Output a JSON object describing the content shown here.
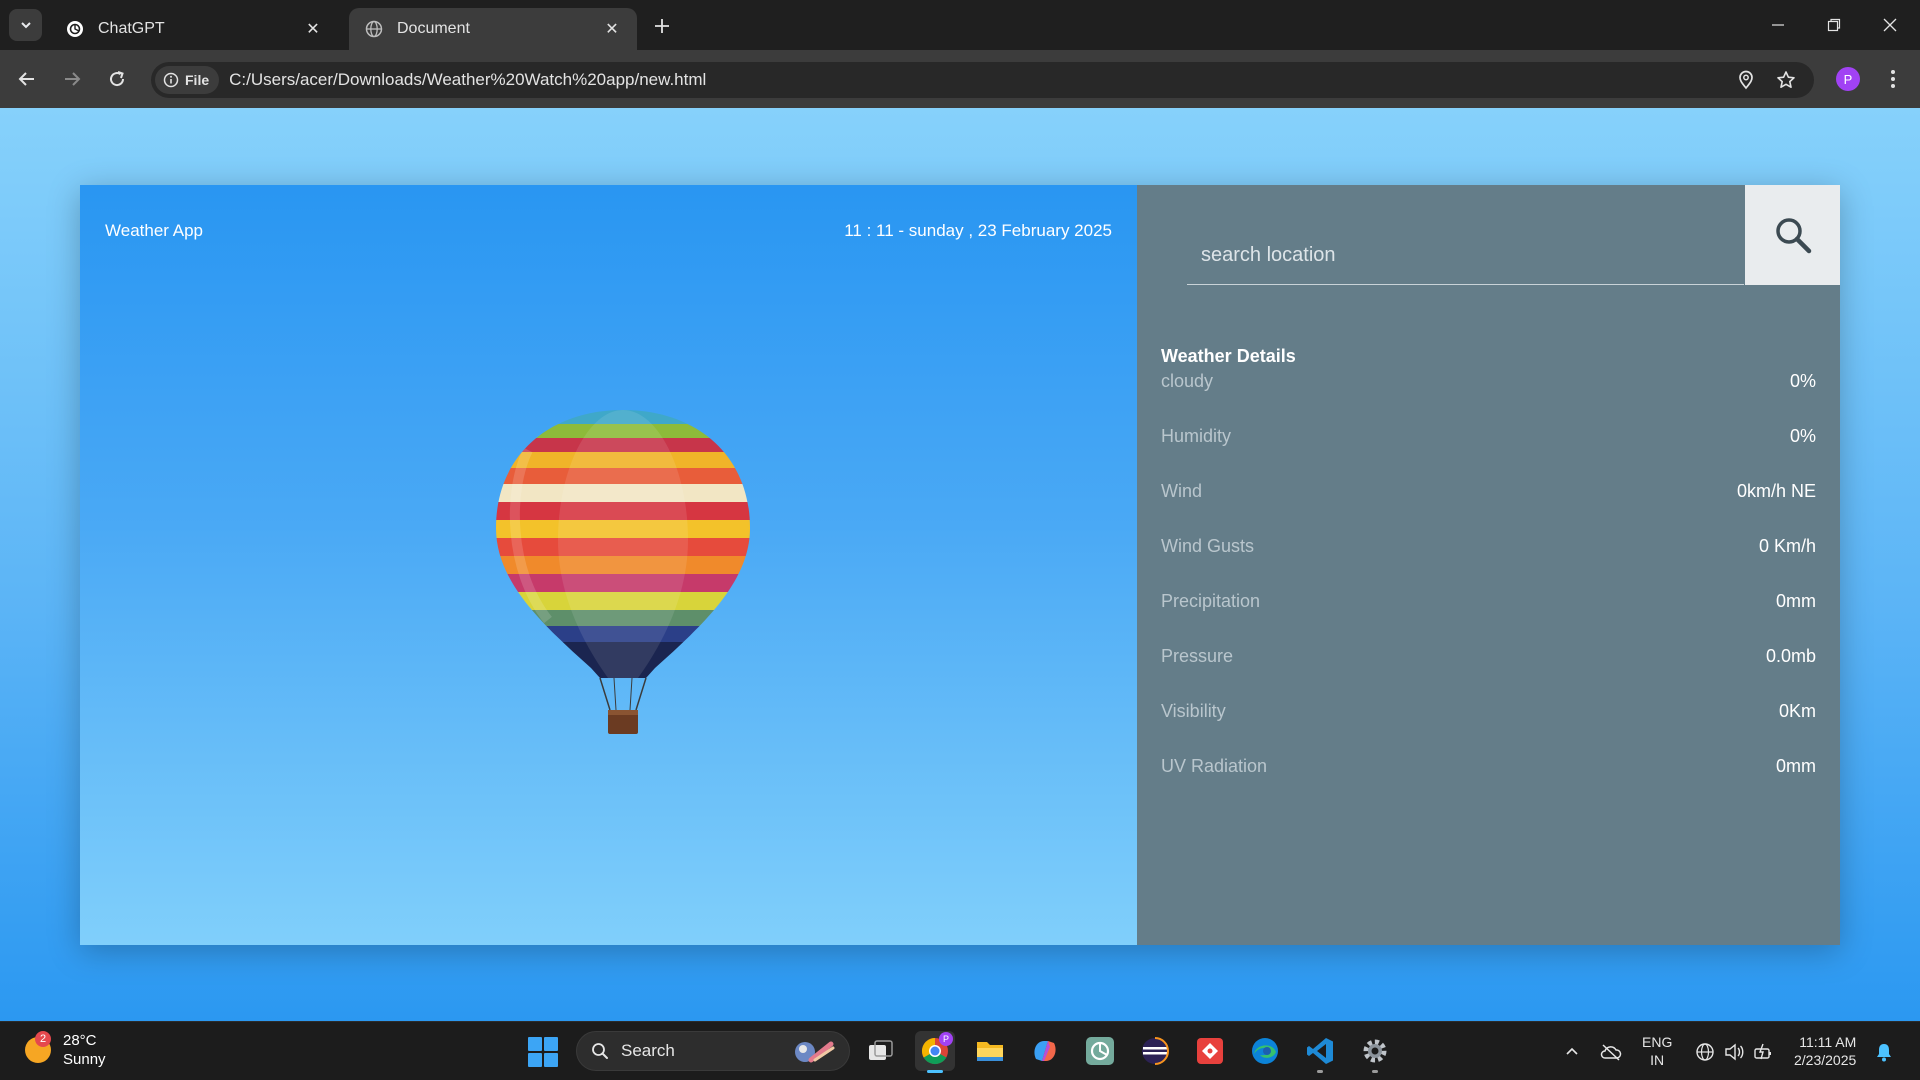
{
  "browser": {
    "tabs": [
      {
        "title": "ChatGPT",
        "active": false
      },
      {
        "title": "Document",
        "active": true
      }
    ],
    "site_chip": "File",
    "url": "C:/Users/acer/Downloads/Weather%20Watch%20app/new.html",
    "profile_initial": "P"
  },
  "app": {
    "brand": "Weather App",
    "datetime": "11 : 11 - sunday , 23 February 2025",
    "search": {
      "placeholder": "search location",
      "value": ""
    },
    "details_title": "Weather Details",
    "details": [
      {
        "label": "cloudy",
        "value": "0%"
      },
      {
        "label": "Humidity",
        "value": "0%"
      },
      {
        "label": "Wind",
        "value": "0km/h NE"
      },
      {
        "label": "Wind Gusts",
        "value": "0 Km/h"
      },
      {
        "label": "Precipitation",
        "value": "0mm"
      },
      {
        "label": "Pressure",
        "value": "0.0mb"
      },
      {
        "label": "Visibility",
        "value": "0Km"
      },
      {
        "label": "UV Radiation",
        "value": "0mm"
      }
    ]
  },
  "taskbar": {
    "weather": {
      "temp": "28°C",
      "condition": "Sunny",
      "badge": "2"
    },
    "search_label": "Search",
    "chrome_badge": "P",
    "language": {
      "line1": "ENG",
      "line2": "IN"
    },
    "clock": {
      "time": "11:11 AM",
      "date": "2/23/2025"
    }
  },
  "colors": {
    "accent_blue": "#2996f2",
    "panel_gray": "#647d89",
    "chrome_dark": "#1f1f1f"
  }
}
